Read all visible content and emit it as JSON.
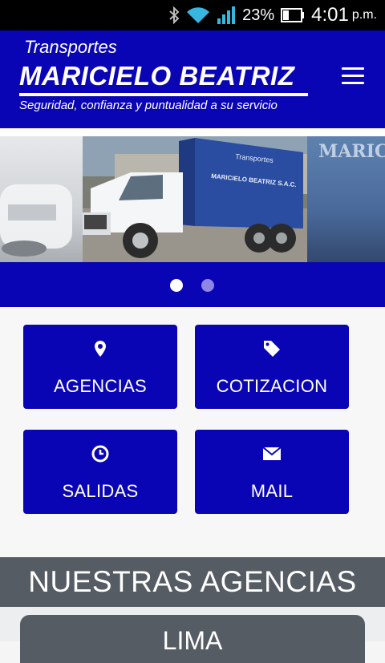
{
  "status_bar": {
    "battery": "23%",
    "time": "4:01",
    "ampm": "p.m."
  },
  "header": {
    "brand_top": "Transportes",
    "brand_main": "MARICIELO BEATRIZ",
    "tagline": "Seguridad, confianza y puntualidad a su servicio"
  },
  "carousel": {
    "next_slide_text": "MARICIELO",
    "truck_text": "MARICIELO BEATRIZ S.A.C.",
    "slides_count": 2,
    "active_slide": 1
  },
  "tiles": [
    {
      "label": "AGENCIAS",
      "icon": "map-pin-icon"
    },
    {
      "label": "COTIZACION",
      "icon": "tag-icon"
    },
    {
      "label": "SALIDAS",
      "icon": "clock-icon"
    },
    {
      "label": "MAIL",
      "icon": "envelope-icon"
    }
  ],
  "section": {
    "title": "NUESTRAS AGENCIAS",
    "agencies": [
      {
        "name": "LIMA"
      }
    ]
  },
  "colors": {
    "brand_blue": "#0a05b4",
    "section_gray": "#565c63"
  }
}
